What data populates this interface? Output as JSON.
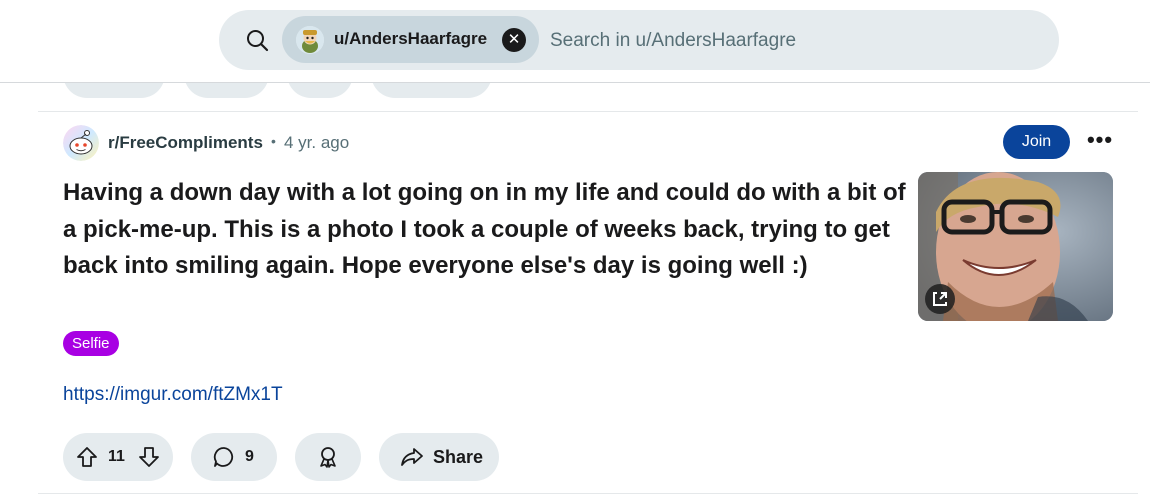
{
  "search": {
    "scope_chip_label": "u/AndersHaarfagre",
    "clear_icon": "close-icon",
    "placeholder": "Search in u/AndersHaarfagre"
  },
  "post": {
    "subreddit": "r/FreeCompliments",
    "separator": "•",
    "age": "4 yr. ago",
    "join_label": "Join",
    "more_label": "•••",
    "title": "Having a down day with a lot going on in my life and could do with a bit of a pick-me-up. This is a photo I took a couple of weeks back, trying to get back into smiling again. Hope everyone else's day is going well :)",
    "flair": "Selfie",
    "link": "https://imgur.com/ftZMx1T",
    "votes": "11",
    "comments": "9",
    "share_label": "Share"
  },
  "colors": {
    "join_bg": "#0a449b",
    "flair_bg": "#a800e3",
    "link": "#0a449b",
    "pill_bg": "#e5ebee"
  }
}
